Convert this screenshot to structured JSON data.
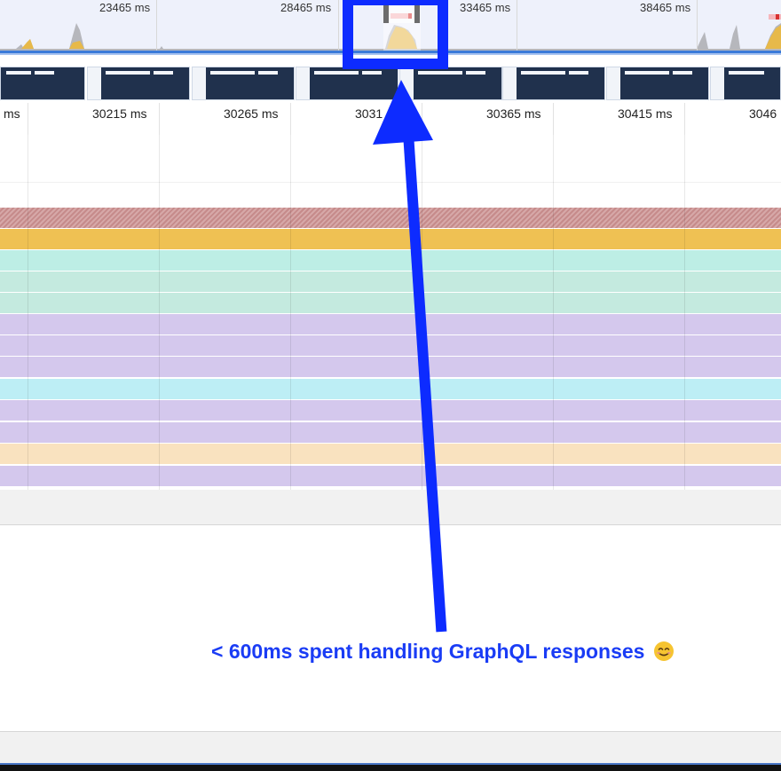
{
  "overview": {
    "labels": [
      "23465 ms",
      "28465 ms",
      "33465 ms",
      "38465 ms"
    ]
  },
  "ruler": {
    "labels": [
      "ms",
      "30215 ms",
      "30265 ms",
      "3031",
      "30365 ms",
      "30415 ms",
      "3046"
    ]
  },
  "tracks": {
    "colors": {
      "hatched": "#c99a9a",
      "scripting_yellow": "#efc153",
      "teal": "#bdeee5",
      "mint": "#c4eadf",
      "lavender": "#d4c8ed",
      "cyan": "#bdeef5",
      "peach": "#f9e2bf"
    }
  },
  "annotation": {
    "text": "< 600ms spent handling GraphQL responses",
    "emoji": "smiling-face-icon",
    "color": "#1a3cf5"
  }
}
